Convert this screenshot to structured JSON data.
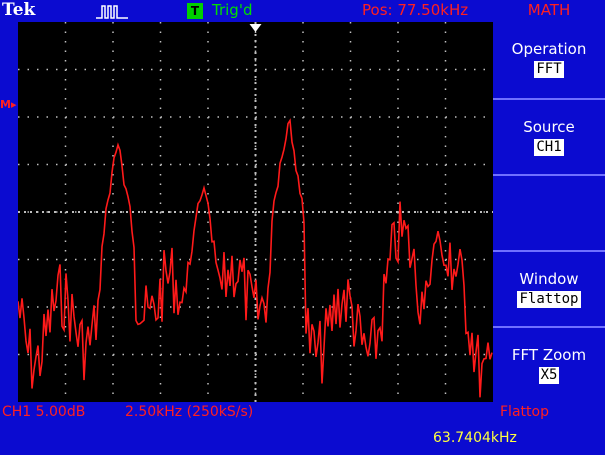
{
  "header": {
    "brand": "Tek",
    "acquisition_icon": "pulse-train-icon",
    "trigger_badge": "T",
    "trigger_status": "Trig'd",
    "position": "Pos: 77.50kHz",
    "menu_title": "MATH"
  },
  "menu": {
    "items": [
      {
        "label": "Operation",
        "value": "FFT"
      },
      {
        "label": "Source",
        "value": "CH1"
      },
      {
        "label": "",
        "value": ""
      },
      {
        "label": "Window",
        "value": "Flattop"
      },
      {
        "label": "FFT Zoom",
        "value": "X5"
      }
    ]
  },
  "screen": {
    "math_marker": "M",
    "trace_color": "#ff1a1a",
    "grid_color": "#bfbfbf",
    "trigger_marker_icon": "trigger-position-arrow-icon"
  },
  "status": {
    "channel_scale": "CH1 5.00dB",
    "freq_scale": "2.50kHz (250kS/s)",
    "window": "Flattop",
    "frequency_readout": "63.7404kHz"
  },
  "colors": {
    "background": "#0b0bd0",
    "screen": "#000000",
    "label_red": "#ff2020",
    "trig_green": "#00e000",
    "readout_yellow": "#ffff40"
  }
}
